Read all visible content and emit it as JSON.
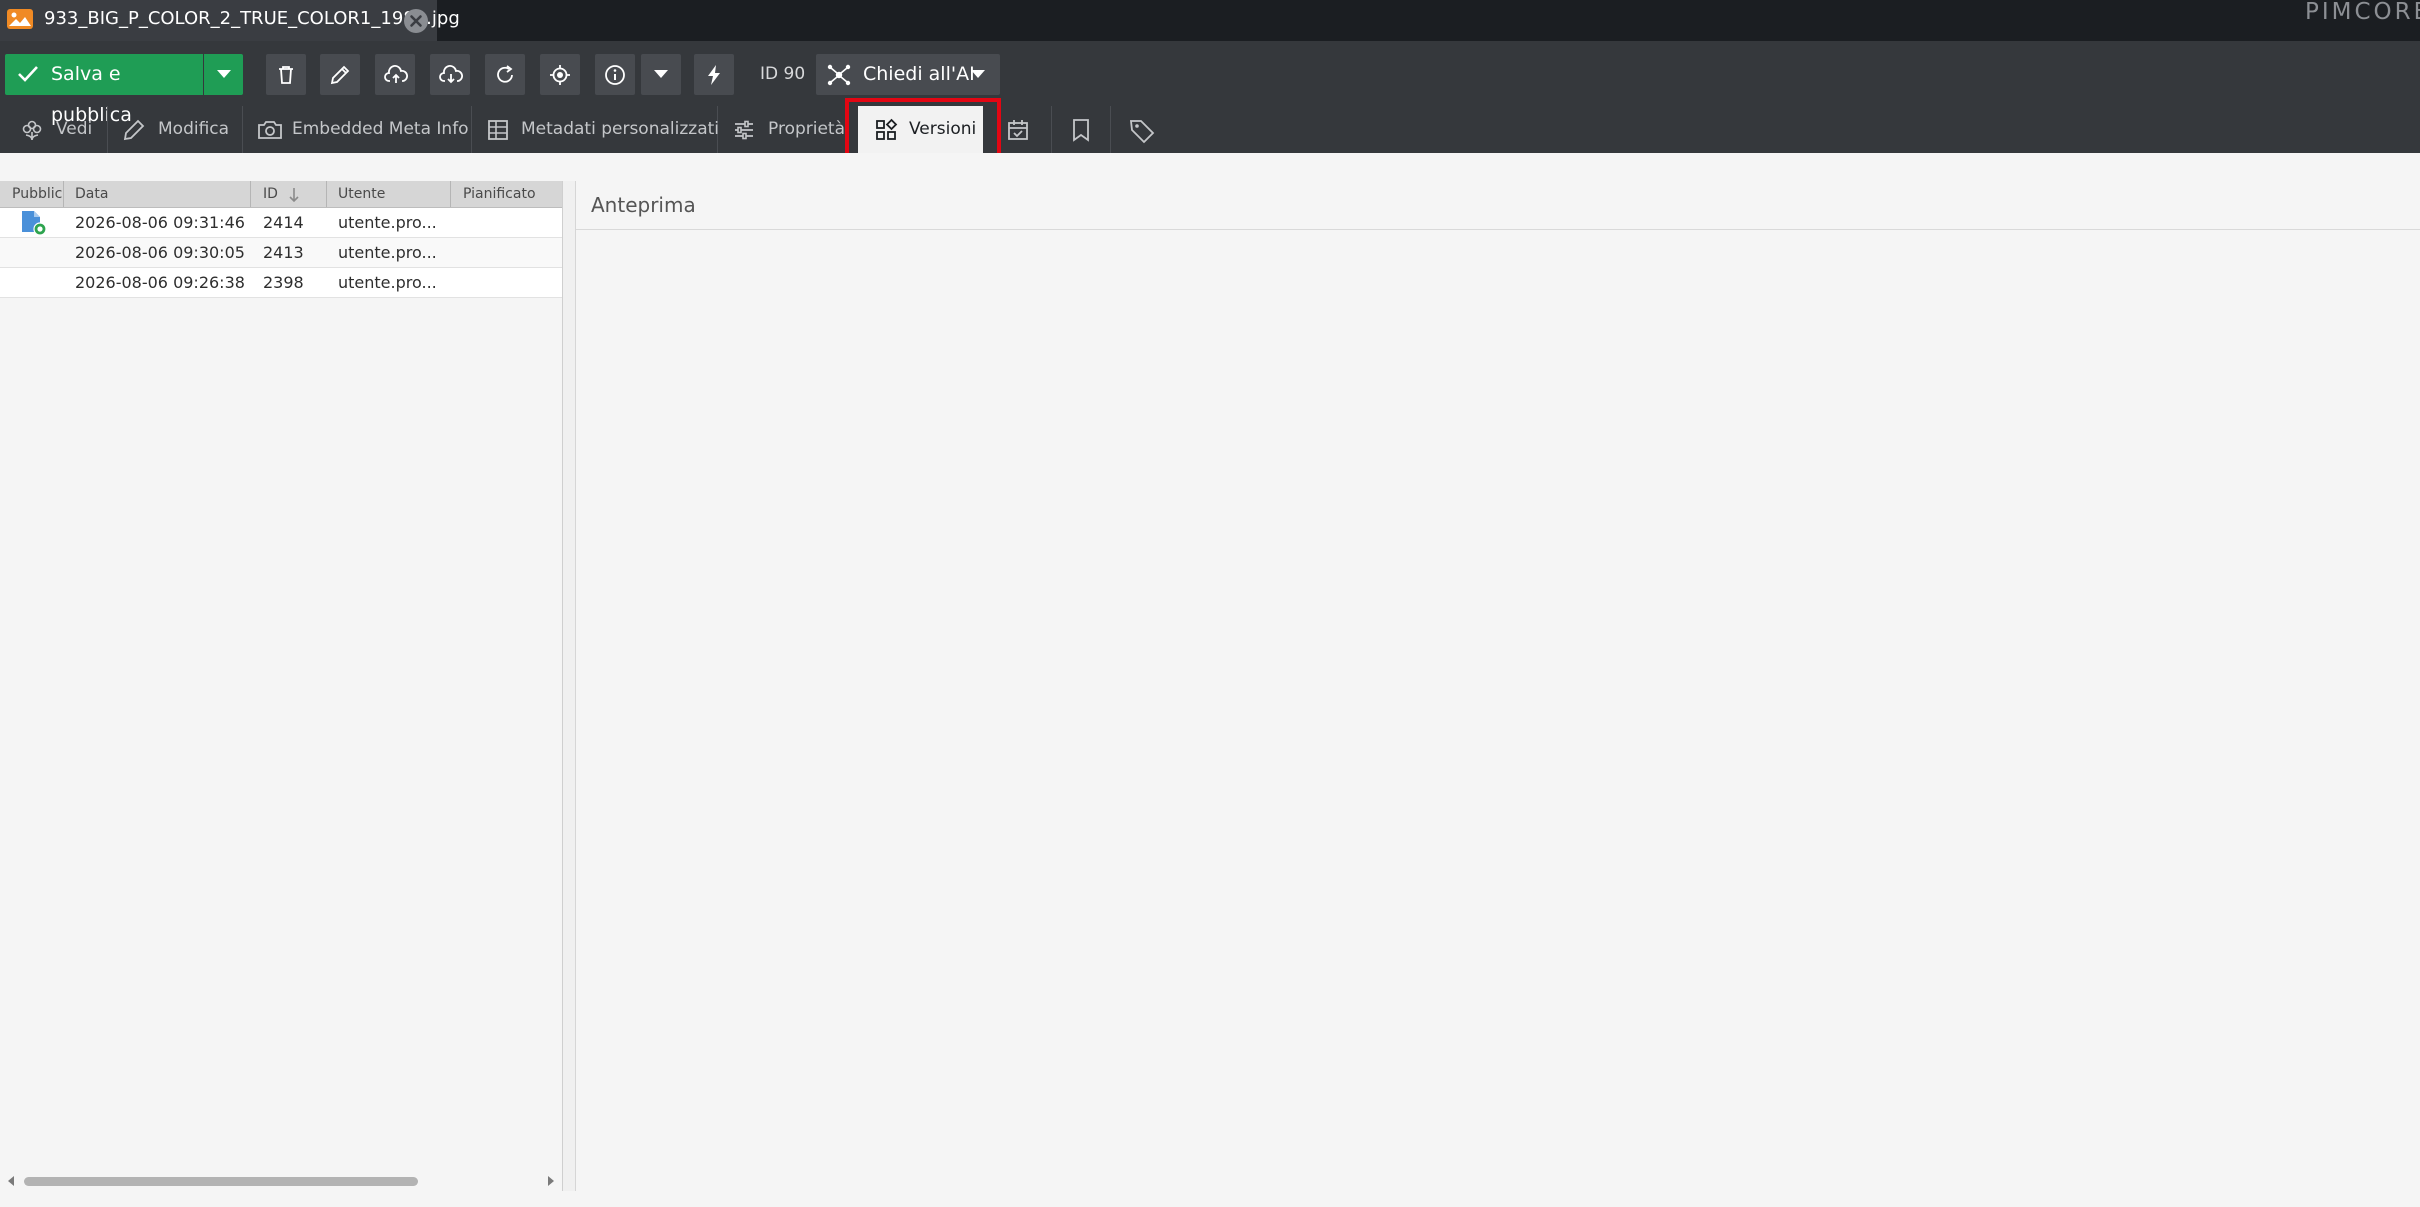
{
  "tab": {
    "title": "933_BIG_P_COLOR_2_TRUE_COLOR1_1980.jpg"
  },
  "logo": {
    "text": "PIMCORE"
  },
  "toolbar": {
    "publish_label": "Salva e pubblica",
    "id_label": "ID 90",
    "ai_label": "Chiedi all'AI"
  },
  "subtabs": [
    {
      "label": "Vedi"
    },
    {
      "label": "Modifica"
    },
    {
      "label": "Embedded Meta Info"
    },
    {
      "label": "Metadati personalizzati"
    },
    {
      "label": "Proprietà"
    },
    {
      "label": "Versioni",
      "active": true
    }
  ],
  "versions_grid": {
    "columns": [
      "Pubblicato",
      "Data",
      "ID",
      "Utente",
      "Pianificato"
    ],
    "sort_column": "ID",
    "sort_direction": "desc",
    "rows": [
      {
        "published": true,
        "date": "2026-08-06 09:31:46",
        "id": "2414",
        "user": "utente.pro...",
        "scheduled": ""
      },
      {
        "published": false,
        "date": "2026-08-06 09:30:05",
        "id": "2413",
        "user": "utente.pro...",
        "scheduled": ""
      },
      {
        "published": false,
        "date": "2026-08-06 09:26:38",
        "id": "2398",
        "user": "utente.pro...",
        "scheduled": ""
      }
    ]
  },
  "preview": {
    "title": "Anteprima"
  },
  "colors": {
    "primary": "#1f9d55",
    "toolbar": "#35383c",
    "highlight": "#e30613"
  }
}
